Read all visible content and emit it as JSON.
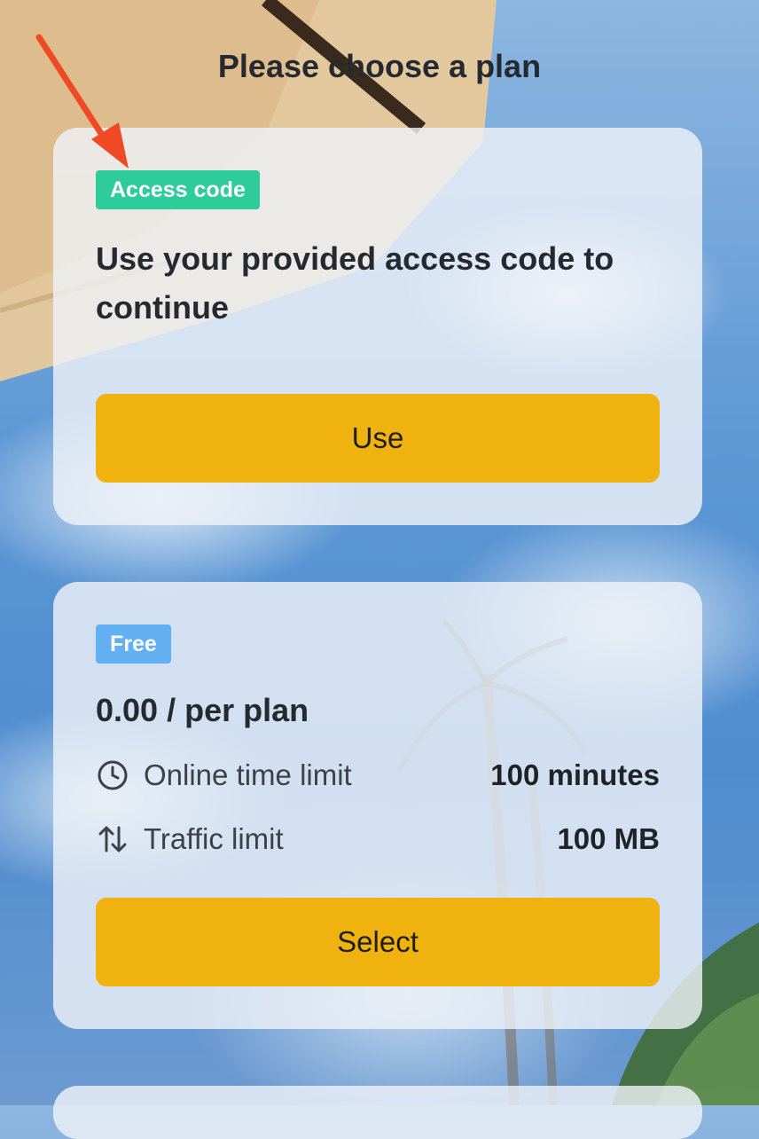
{
  "page": {
    "title": "Please choose a plan"
  },
  "plans": [
    {
      "badge": "Access code",
      "badge_color": "#2ecc9a",
      "description": "Use your provided access code to continue",
      "button_label": "Use"
    },
    {
      "badge": "Free",
      "badge_color": "#62b0f2",
      "price": "0.00",
      "price_unit": " / per plan",
      "limits": [
        {
          "icon": "clock-icon",
          "label": "Online time limit",
          "value": "100 minutes"
        },
        {
          "icon": "arrows-up-down-icon",
          "label": "Traffic limit",
          "value": "100 MB"
        }
      ],
      "button_label": "Select"
    }
  ],
  "colors": {
    "button": "#f0b20e",
    "annotation_arrow": "#f04a24"
  }
}
